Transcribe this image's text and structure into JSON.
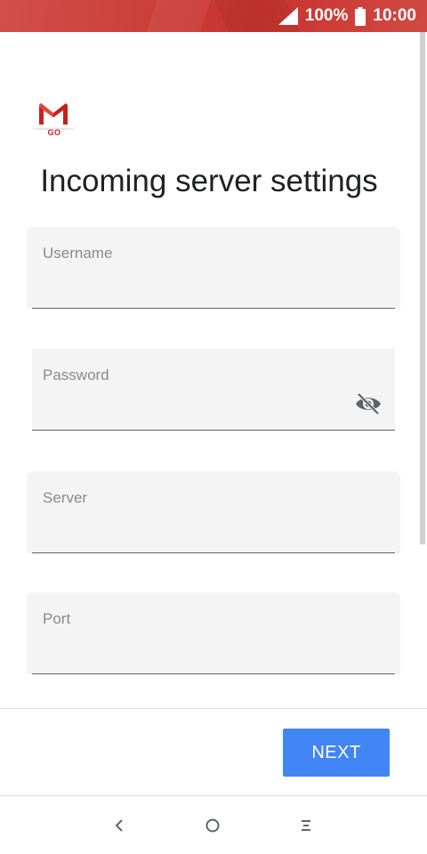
{
  "status_bar": {
    "battery_percent": "100%",
    "time": "10:00"
  },
  "logo": {
    "badge_text": "GO"
  },
  "page": {
    "title": "Incoming server settings"
  },
  "form": {
    "username": {
      "label": "Username",
      "value": ""
    },
    "password": {
      "label": "Password",
      "value": ""
    },
    "server": {
      "label": "Server",
      "value": ""
    },
    "port": {
      "label": "Port",
      "value": ""
    }
  },
  "actions": {
    "next_label": "NEXT"
  },
  "colors": {
    "status_bar": "#c8332f",
    "accent": "#4285f4",
    "field_bg": "#f4f4f4"
  },
  "icons": {
    "signal": "signal-icon",
    "battery": "battery-icon",
    "password_visibility": "eye-off-icon",
    "nav_back": "back-icon",
    "nav_home": "home-icon",
    "nav_menu": "menu-icon"
  }
}
